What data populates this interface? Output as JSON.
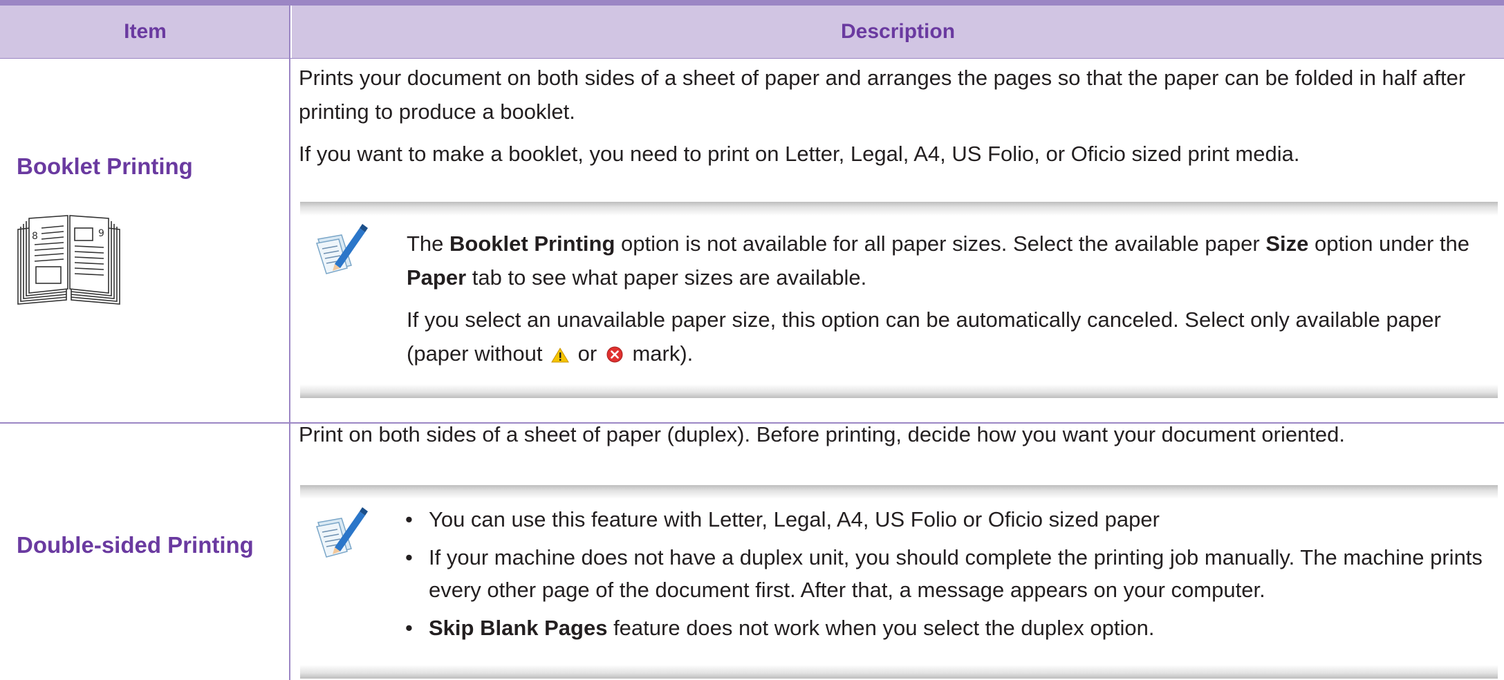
{
  "header": {
    "item_label": "Item",
    "description_label": "Description"
  },
  "rows": [
    {
      "item": "Booklet Printing",
      "icon": "booklet-icon",
      "booklet_page_left": "8",
      "booklet_page_right": "9",
      "desc_para1": "Prints your document on both sides of a sheet of paper and arranges the pages so that the paper can be folded in half after printing to produce a booklet.",
      "desc_para2": "If you want to make a booklet, you need to print on Letter, Legal, A4, US Folio, or Oficio sized print media.",
      "note": {
        "icon": "note-pencil-icon",
        "p1_a": "The ",
        "p1_b": "Booklet Printing",
        "p1_c": " option is not available for all paper sizes. Select the available paper ",
        "p1_d": "Size",
        "p1_e": " option under the ",
        "p1_f": "Paper",
        "p1_g": " tab to see what paper sizes are available.",
        "p2_a": "If you select an unavailable paper size, this option can be automatically canceled. Select only available paper (paper without ",
        "p2_b": " or ",
        "p2_c": " mark).",
        "warning_icon": "warning-icon",
        "error_icon": "error-icon"
      }
    },
    {
      "item": "Double-sided Printing",
      "desc_para1": "Print on both sides of a sheet of paper (duplex). Before printing, decide how you want your document oriented.",
      "note": {
        "icon": "note-pencil-icon",
        "bullet1": "You can use this feature with Letter, Legal, A4, US Folio or Oficio sized paper",
        "bullet2": "If your machine does not have a duplex unit, you should complete the printing job manually. The machine prints every other page of the document first. After that, a message appears on your computer.",
        "bullet3_bold": "Skip Blank Pages",
        "bullet3_rest": " feature does not work when you select the duplex option.",
        "bullet_char": "•"
      }
    }
  ],
  "colors": {
    "header_bg": "#d1c5e3",
    "accent_text": "#6a3aa0",
    "rule": "#9b86c4"
  }
}
